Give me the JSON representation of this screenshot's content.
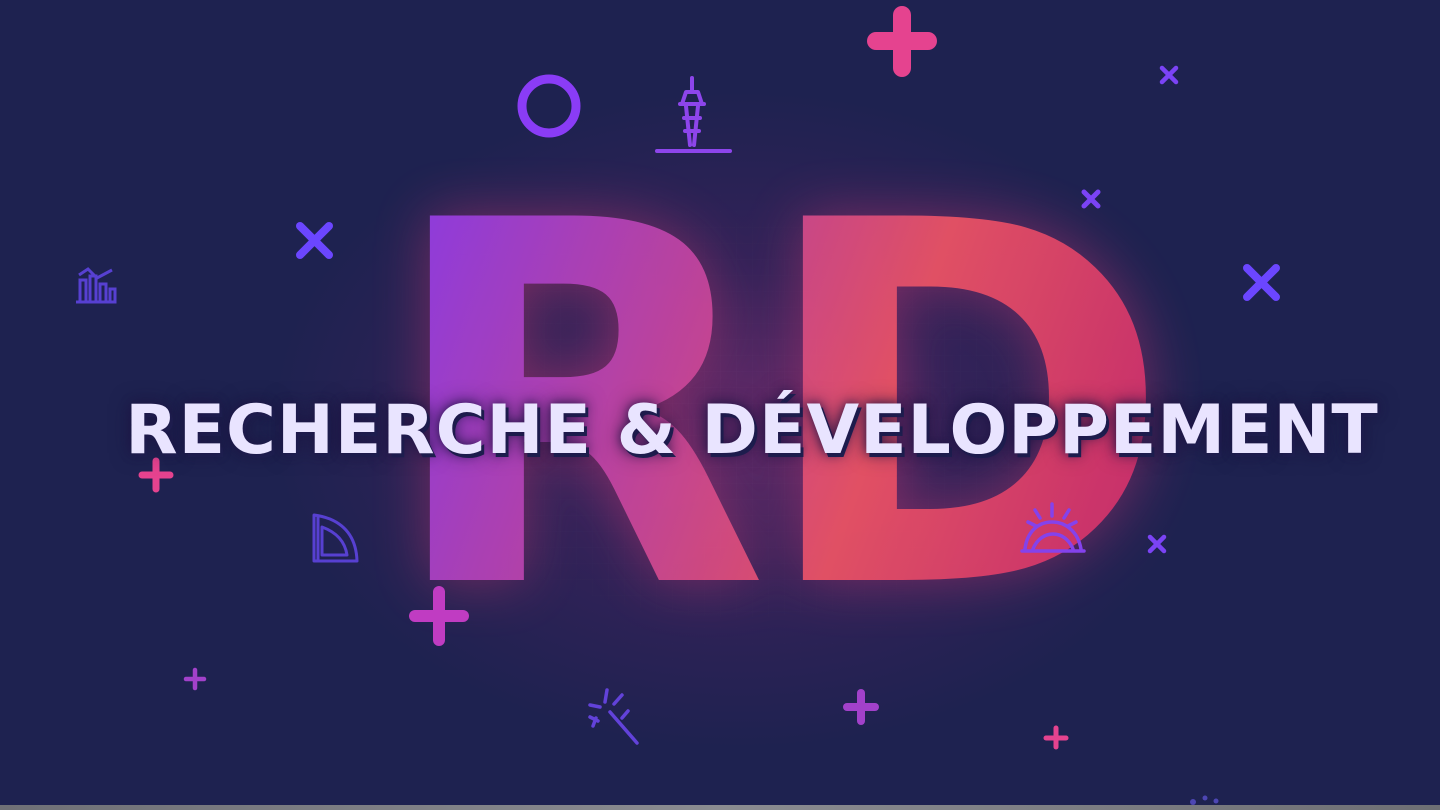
{
  "banner": {
    "big_letters": "RD",
    "headline": "RECHERCHE & DÉVELOPPEMENT"
  },
  "colors": {
    "background": "#1e2250",
    "purple_accent": "#7b43f5",
    "pink_accent": "#e5438f",
    "magenta_accent": "#c03cc2",
    "headline_text": "#e9e4ff"
  },
  "icons": [
    "plus-icon",
    "circle-icon",
    "tower-icon",
    "close-icon",
    "bar-chart-icon",
    "protractor-icon",
    "rocket-icon",
    "magic-wand-icon"
  ]
}
